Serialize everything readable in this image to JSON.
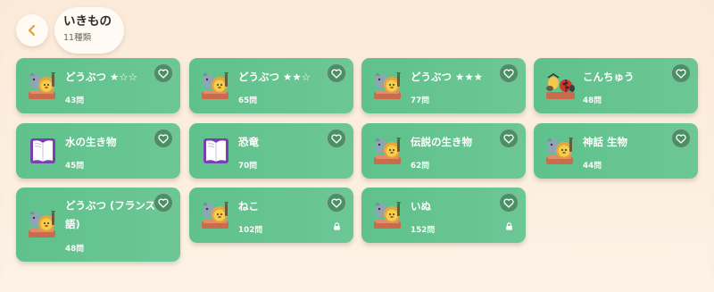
{
  "header": {
    "title": "いきもの",
    "count": "11種類"
  },
  "cards": [
    {
      "name": "どうぶつ ★☆☆",
      "count": "43問",
      "icon": "lion-icon",
      "locked": false
    },
    {
      "name": "どうぶつ ★★☆",
      "count": "65問",
      "icon": "lion-icon",
      "locked": false
    },
    {
      "name": "どうぶつ ★★★",
      "count": "77問",
      "icon": "lion-icon",
      "locked": false
    },
    {
      "name": "こんちゅう",
      "count": "48問",
      "icon": "insects-icon",
      "locked": false
    },
    {
      "name": "水の生き物",
      "count": "45問",
      "icon": "book-icon",
      "locked": false
    },
    {
      "name": "恐竜",
      "count": "70問",
      "icon": "book-icon",
      "locked": false
    },
    {
      "name": "伝説の生き物",
      "count": "62問",
      "icon": "lion-icon",
      "locked": false
    },
    {
      "name": "神話 生物",
      "count": "44問",
      "icon": "lion-icon",
      "locked": false
    },
    {
      "name": "どうぶつ (フランス語)",
      "count": "48問",
      "icon": "lion-icon",
      "locked": false
    },
    {
      "name": "ねこ",
      "count": "102問",
      "icon": "lion-icon",
      "locked": true
    },
    {
      "name": "いぬ",
      "count": "152問",
      "icon": "lion-icon",
      "locked": true
    }
  ],
  "colors": {
    "card": "#62c28e",
    "heart_bg": "#4a8f66",
    "background": "#fbead9",
    "back_arrow": "#e0a23a"
  }
}
